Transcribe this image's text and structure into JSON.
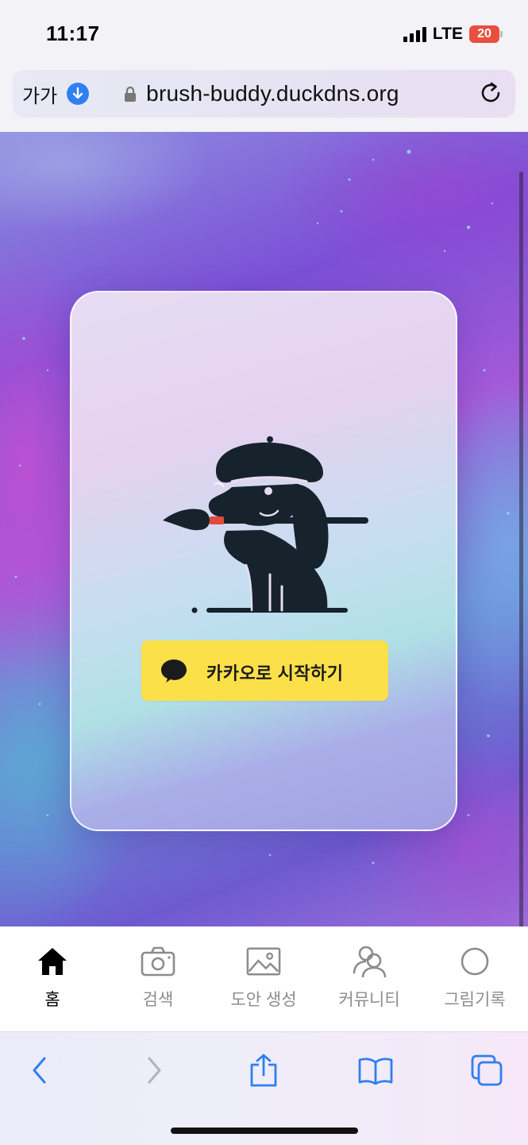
{
  "status_bar": {
    "time": "11:17",
    "network": "LTE",
    "battery": "20"
  },
  "address_bar": {
    "text_size_label": "가가",
    "url": "brush-buddy.duckdns.org"
  },
  "login": {
    "kakao_button_label": "카카오로 시작하기"
  },
  "tabs": [
    {
      "label": "홈",
      "icon": "home-icon",
      "active": true
    },
    {
      "label": "검색",
      "icon": "camera-icon",
      "active": false
    },
    {
      "label": "도안 생성",
      "icon": "image-icon",
      "active": false
    },
    {
      "label": "커뮤니티",
      "icon": "community-icon",
      "active": false
    },
    {
      "label": "그림기록",
      "icon": "circle-icon",
      "active": false
    }
  ],
  "toolbar": {
    "icons": [
      "back-icon",
      "forward-icon",
      "share-icon",
      "bookmarks-icon",
      "tabs-icon"
    ]
  },
  "colors": {
    "kakao_yellow": "#fbe04a",
    "safari_blue": "#2f7ff0",
    "active_tab": "#000000",
    "inactive_tab": "#8c8c8c"
  }
}
